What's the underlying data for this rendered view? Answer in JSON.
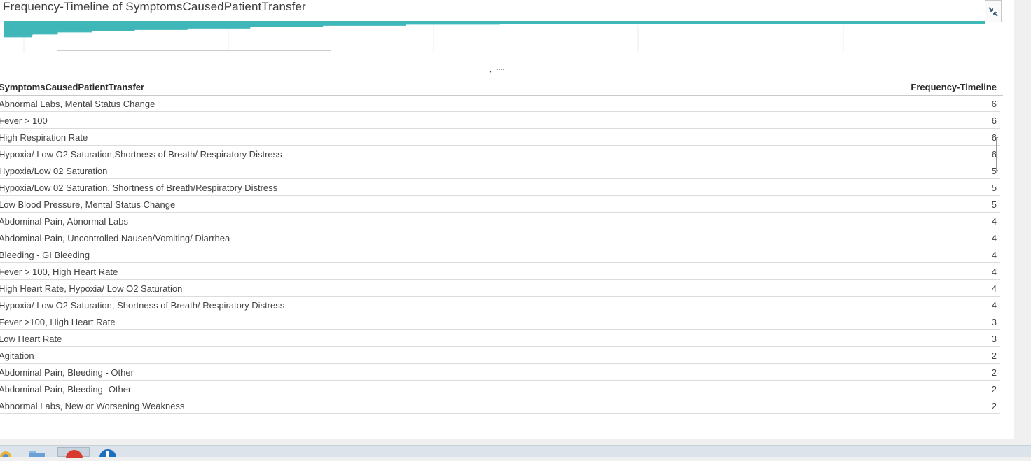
{
  "panel": {
    "title": "Frequency-Timeline of SymptomsCausedPatientTransfer",
    "restore_icon": "restore-minimize-icon"
  },
  "overview": {
    "bar_color": "#3fb6b8",
    "bar_values": [
      15,
      13,
      12,
      12,
      12,
      11,
      11,
      11,
      10,
      10,
      10,
      9,
      9,
      9,
      9,
      8,
      8,
      8,
      8,
      7,
      7,
      7,
      7,
      6,
      6,
      6,
      6,
      5,
      5,
      5,
      4,
      4,
      4,
      4,
      4,
      4,
      3,
      3,
      2,
      2,
      2,
      2,
      1,
      1
    ]
  },
  "table": {
    "columns": [
      "SymptomsCausedPatientTransfer",
      "Frequency-Timeline"
    ],
    "rows": [
      {
        "label": "Abnormal Labs, Mental Status Change",
        "value": "6"
      },
      {
        "label": "Fever > 100",
        "value": "6"
      },
      {
        "label": "High Respiration Rate",
        "value": "6"
      },
      {
        "label": "Hypoxia/ Low O2 Saturation,Shortness of Breath/ Respiratory Distress",
        "value": "6"
      },
      {
        "label": "Hypoxia/Low 02 Saturation",
        "value": "5"
      },
      {
        "label": "Hypoxia/Low 02 Saturation, Shortness of Breath/Respiratory Distress",
        "value": "5"
      },
      {
        "label": "Low Blood Pressure, Mental Status Change",
        "value": "5"
      },
      {
        "label": "Abdominal Pain, Abnormal Labs",
        "value": "4"
      },
      {
        "label": "Abdominal Pain, Uncontrolled Nausea/Vomiting/ Diarrhea",
        "value": "4"
      },
      {
        "label": "Bleeding - GI Bleeding",
        "value": "4"
      },
      {
        "label": "Fever > 100, High Heart Rate",
        "value": "4"
      },
      {
        "label": "High Heart Rate, Hypoxia/ Low O2 Saturation",
        "value": "4"
      },
      {
        "label": "Hypoxia/ Low O2 Saturation, Shortness of Breath/ Respiratory Distress",
        "value": "4"
      },
      {
        "label": "Fever >100, High Heart Rate",
        "value": "3"
      },
      {
        "label": "Low Heart Rate",
        "value": "3"
      },
      {
        "label": "Agitation",
        "value": "2"
      },
      {
        "label": "Abdominal Pain, Bleeding - Other",
        "value": "2"
      },
      {
        "label": "Abdominal Pain, Bleeding- Other",
        "value": "2"
      },
      {
        "label": "Abnormal Labs, New or Worsening Weakness",
        "value": "2"
      }
    ]
  }
}
